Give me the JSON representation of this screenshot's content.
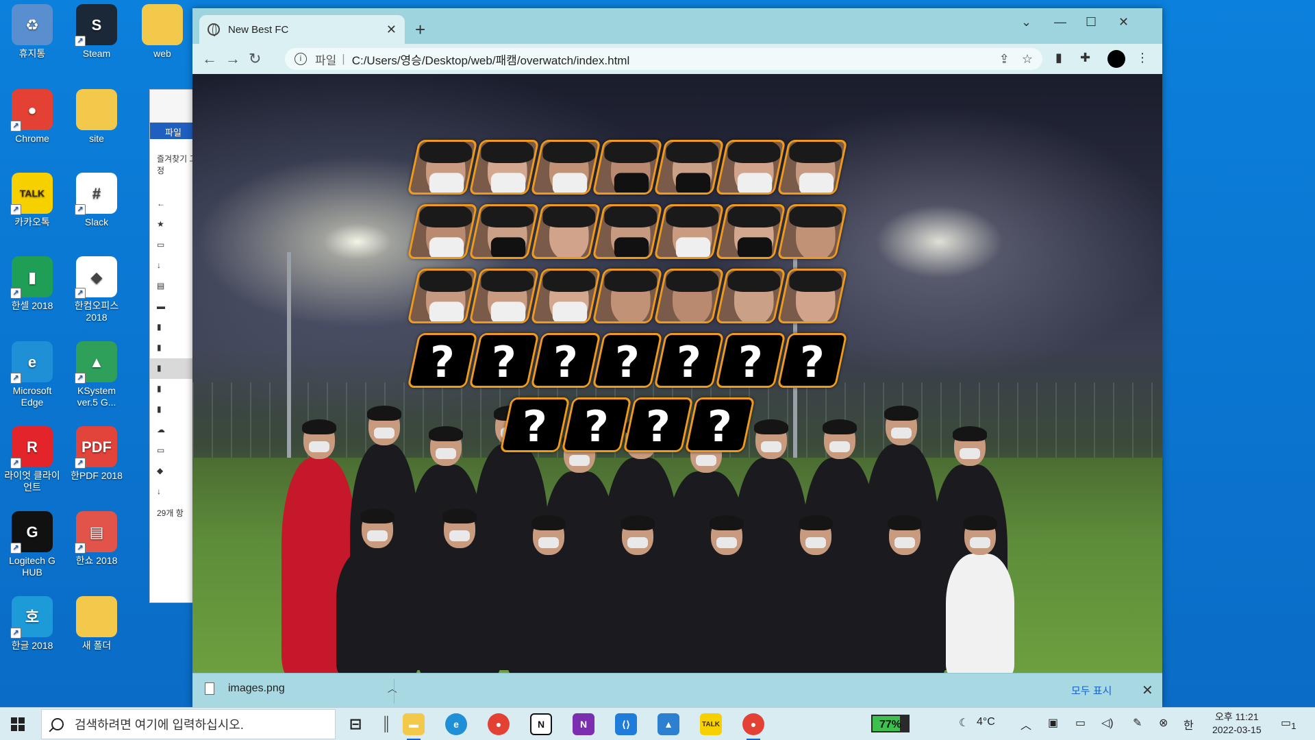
{
  "desktop": {
    "icons": [
      {
        "label": "휴지통",
        "name": "recycle-bin-icon",
        "color": "#5a8fcf",
        "glyph": "♻"
      },
      {
        "label": "Steam",
        "name": "steam-icon",
        "color": "#1b2838",
        "glyph": "S"
      },
      {
        "label": "web",
        "name": "folder-web-icon",
        "color": "#f3c94b",
        "glyph": ""
      },
      {
        "label": "Chrome",
        "name": "chrome-icon",
        "color": "#e34133",
        "glyph": "●"
      },
      {
        "label": "site",
        "name": "folder-site-icon",
        "color": "#f3c94b",
        "glyph": ""
      },
      {
        "label": "카카오톡",
        "name": "kakaotalk-icon",
        "color": "#f7d000",
        "glyph": "TALK"
      },
      {
        "label": "Slack",
        "name": "slack-icon",
        "color": "#ffffff",
        "glyph": "#"
      },
      {
        "label": "한셀 2018",
        "name": "hancell-icon",
        "color": "#1f9e55",
        "glyph": "▮"
      },
      {
        "label": "한컴오피스 2018",
        "name": "hancom-office-icon",
        "color": "#ffffff",
        "glyph": "◆"
      },
      {
        "label": "Microsoft Edge",
        "name": "edge-icon",
        "color": "#1f8fd6",
        "glyph": "e"
      },
      {
        "label": "KSystem ver.5 G...",
        "name": "ksystem-icon",
        "color": "#2fa05a",
        "glyph": "▲"
      },
      {
        "label": "라이엇 클라이언트",
        "name": "riot-client-icon",
        "color": "#e3242b",
        "glyph": "R"
      },
      {
        "label": "한PDF 2018",
        "name": "hanpdf-icon",
        "color": "#e2433a",
        "glyph": "PDF"
      },
      {
        "label": "Logitech G HUB",
        "name": "logitech-ghub-icon",
        "color": "#111111",
        "glyph": "G"
      },
      {
        "label": "한쇼 2018",
        "name": "hanshow-icon",
        "color": "#e2544a",
        "glyph": "▤"
      },
      {
        "label": "한글 2018",
        "name": "hangul-icon",
        "color": "#1c9bd8",
        "glyph": "호"
      },
      {
        "label": "새 폴더",
        "name": "new-folder-icon",
        "color": "#f3c94b",
        "glyph": ""
      }
    ]
  },
  "explorer": {
    "tab_label": "파일",
    "quick_access": "즐겨찾기 고정",
    "item_count": "29개 항"
  },
  "browser": {
    "tab_title": "New Best FC",
    "address_protocol": "파일",
    "address_url": "C:/Users/영승/Desktop/web/패캠/overwatch/index.html",
    "accent": "#f09a1d"
  },
  "roster": {
    "known_players": 21,
    "unknown_placeholder": "?",
    "unknown_slots": 11
  },
  "downloads": {
    "file_name": "images.png",
    "show_all": "모두 표시"
  },
  "taskbar": {
    "search_placeholder": "검색하려면 여기에 입력하십시오.",
    "battery": "77%",
    "battery_level": 0.77,
    "weather": "4°C",
    "ime": "한",
    "time": "오후 11:21",
    "date": "2022-03-15",
    "notifications": "1"
  }
}
